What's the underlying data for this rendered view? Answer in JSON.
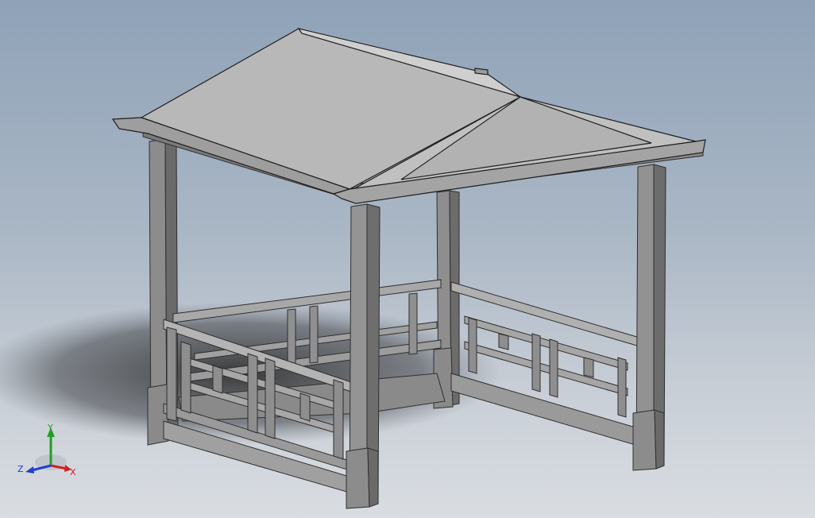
{
  "viewport": {
    "scene": "gazebo-model",
    "background_top": "#8fa2b8",
    "background_bottom": "#d9dde2"
  },
  "triad": {
    "x_label": "X",
    "y_label": "Y",
    "z_label": "Z",
    "x_color": "#d02020",
    "y_color": "#20a020",
    "z_color": "#2040d0"
  }
}
